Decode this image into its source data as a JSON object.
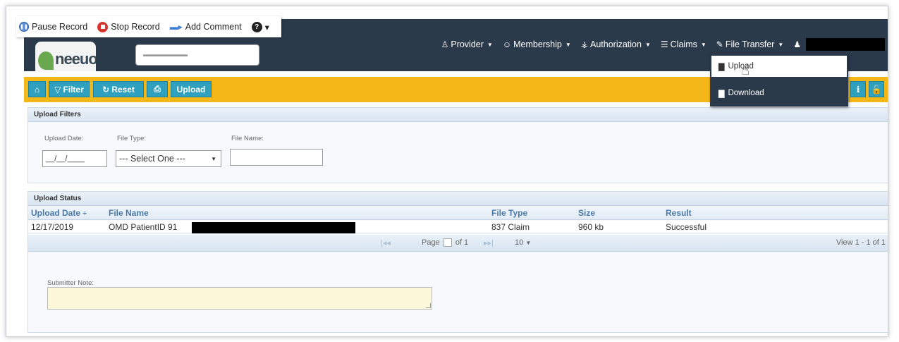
{
  "recorder": {
    "pause_label": "Pause Record",
    "stop_label": "Stop Record",
    "comment_label": "Add Comment",
    "help_caret": "▾"
  },
  "nav": {
    "items": [
      {
        "label": "Provider",
        "icon": "provider-icon"
      },
      {
        "label": "Membership",
        "icon": "user-icon"
      },
      {
        "label": "Authorization",
        "icon": "sitemap-icon"
      },
      {
        "label": "Claims",
        "icon": "list-icon"
      },
      {
        "label": "File Transfer",
        "icon": "file-edit-icon"
      }
    ]
  },
  "toolbar": {
    "filter_label": "Filter",
    "reset_label": "Reset",
    "upload_label": "Upload"
  },
  "dropdown": {
    "upload_label": "Upload",
    "download_label": "Download"
  },
  "filters": {
    "title": "Upload Filters",
    "date_label": "Upload Date:",
    "date_value": "__/__/____",
    "type_label": "File Type:",
    "type_value": "--- Select One ---",
    "name_label": "File Name:",
    "name_value": ""
  },
  "status": {
    "title": "Upload Status",
    "columns": [
      "Upload Date",
      "File Name",
      "File Type",
      "Size",
      "Result"
    ],
    "sort_indicator": "÷",
    "rows": [
      {
        "date": "12/17/2019",
        "file_name": "OMD PatientID 91",
        "file_type": "837 Claim",
        "size": "960 kb",
        "result": "Successful"
      }
    ],
    "pager": {
      "page_label": "Page",
      "of_label": "of 1",
      "page_size": "10",
      "view_text": "View 1 - 1 of 1"
    }
  },
  "note": {
    "label": "Submitter Note:"
  },
  "colors": {
    "nav_bg": "#2b3a4b",
    "toolbar_bg": "#f3b818",
    "button_bg": "#2fa0bd"
  }
}
